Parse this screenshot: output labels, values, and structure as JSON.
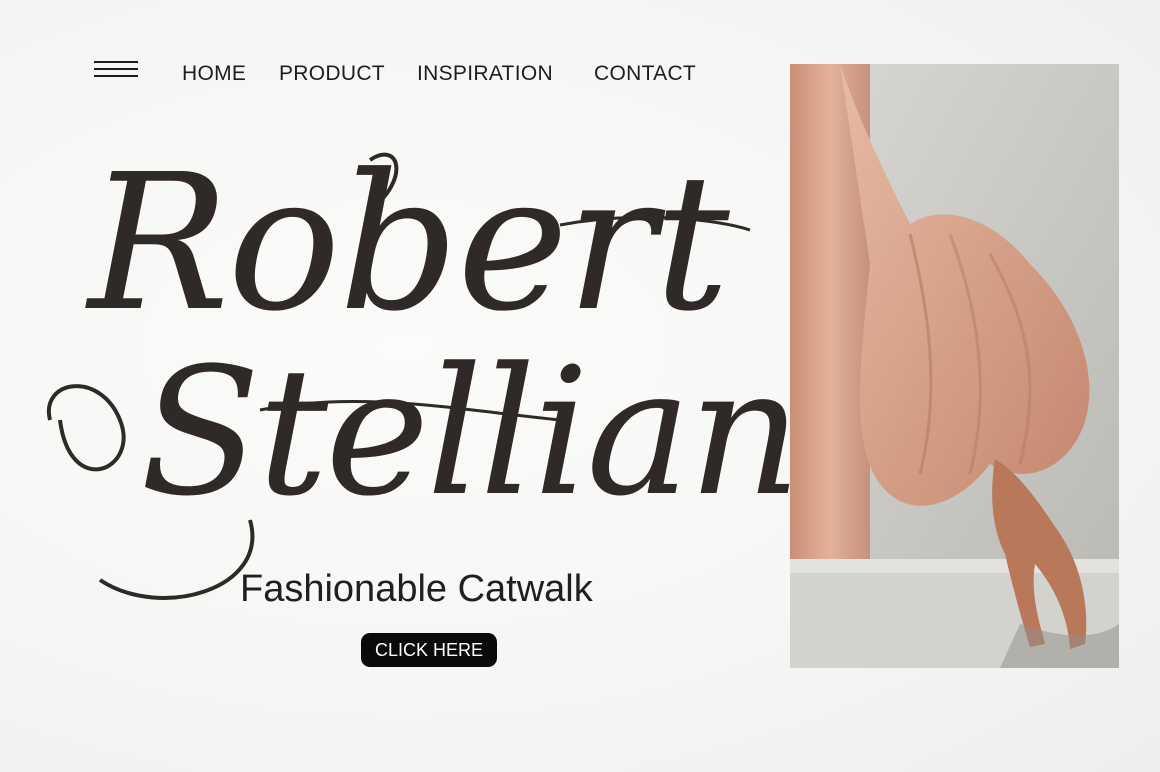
{
  "nav": {
    "menu_icon": "hamburger-menu-icon",
    "items": [
      {
        "label": "HOME"
      },
      {
        "label": "PRODUCT"
      },
      {
        "label": "INSPIRATION"
      },
      {
        "label": "CONTACT"
      }
    ]
  },
  "hero": {
    "title_line_1": "Robert",
    "title_line_2": "Stelliano",
    "subtitle": "Fashionable Catwalk",
    "cta_label": "CLICK HERE"
  },
  "colors": {
    "background": "#f6f6f5",
    "script_text": "#2f2a28",
    "button": "#0a0a0a",
    "fabric": "#dba78f",
    "wall": "#c9c9c4"
  }
}
